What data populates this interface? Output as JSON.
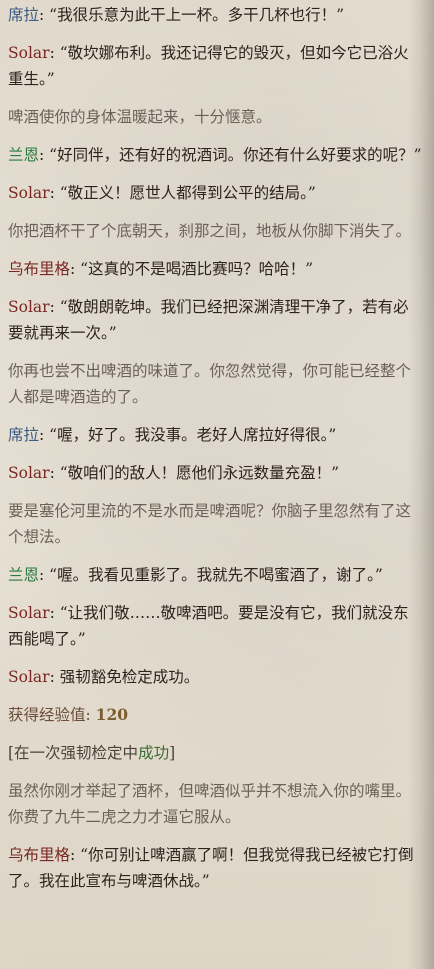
{
  "entries": [
    {
      "speaker": "席拉",
      "text": "“我很乐意为此干上一杯。多干几杯也行！”"
    },
    {
      "speaker": "Solar",
      "text": "“敬坎娜布利。我还记得它的毁灭，但如今它已浴火重生。”"
    },
    {
      "narration": "啤酒使你的身体温暖起来，十分惬意。"
    },
    {
      "speaker": "兰恩",
      "text": "“好同伴，还有好的祝酒词。你还有什么好要求的呢？”"
    },
    {
      "speaker": "Solar",
      "text": "“敬正义！愿世人都得到公平的结局。”"
    },
    {
      "narration": "你把酒杯干了个底朝天，刹那之间，地板从你脚下消失了。"
    },
    {
      "speaker": "乌布里格",
      "text": "“这真的不是喝酒比赛吗？哈哈！”"
    },
    {
      "speaker": "Solar",
      "text": "“敬朗朗乾坤。我们已经把深渊清理干净了，若有必要就再来一次。”"
    },
    {
      "narration": "你再也尝不出啤酒的味道了。你忽然觉得，你可能已经整个人都是啤酒造的了。"
    },
    {
      "speaker": "席拉",
      "text": "“喔，好了。我没事。老好人席拉好得很。”"
    },
    {
      "speaker": "Solar",
      "text": "“敬咱们的敌人！愿他们永远数量充盈！”"
    },
    {
      "narration": "要是塞伦河里流的不是水而是啤酒呢？你脑子里忽然有了这个想法。"
    },
    {
      "speaker": "兰恩",
      "text": "“喔。我看见重影了。我就先不喝蜜酒了，谢了。”"
    },
    {
      "speaker": "Solar",
      "text": "“让我们敬……敬啤酒吧。要是没有它，我们就没东西能喝了。”"
    },
    {
      "speaker": "Solar",
      "text": "强韧豁免检定成功。"
    },
    {
      "xp_label": "获得经验值:",
      "xp_value": "120"
    },
    {
      "check_before": "[在一次强韧检定中",
      "check_result": "成功",
      "check_after": "]"
    },
    {
      "narration": "虽然你刚才举起了酒杯，但啤酒似乎并不想流入你的嘴里。你费了九牛二虎之力才逼它服从。"
    },
    {
      "speaker": "乌布里格",
      "text": "“你可别让啤酒赢了啊！但我觉得我已经被它打倒了。我在此宣布与啤酒休战。”"
    }
  ]
}
